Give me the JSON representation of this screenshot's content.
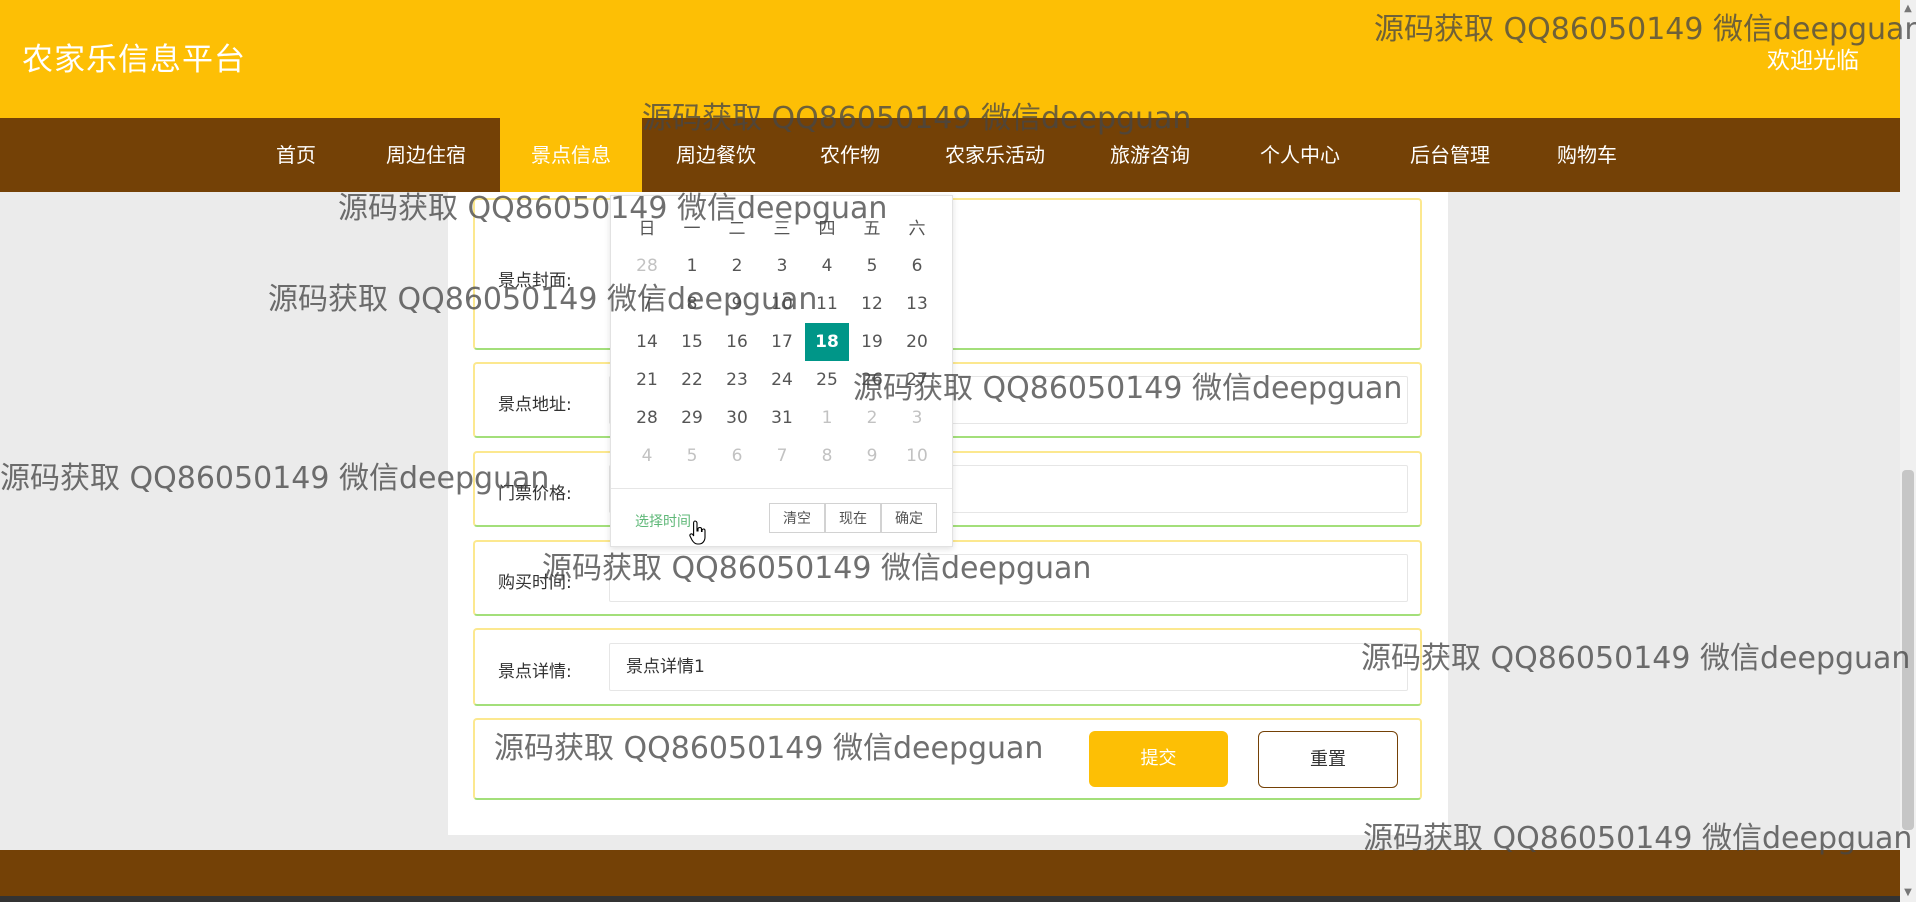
{
  "header": {
    "title": "农家乐信息平台",
    "welcome": "欢迎光临"
  },
  "nav": {
    "items": [
      "首页",
      "周边住宿",
      "景点信息",
      "周边餐饮",
      "农作物",
      "农家乐活动",
      "旅游咨询",
      "个人中心",
      "后台管理",
      "购物车"
    ],
    "active_index": 2
  },
  "form": {
    "cover_label": "景点封面:",
    "address_label": "景点地址:",
    "address_value": "",
    "price_label": "门票价格:",
    "price_value": "",
    "purchase_time_label": "购买时间:",
    "purchase_time_value": "",
    "details_label": "景点详情:",
    "details_value": "景点详情1",
    "submit_label": "提交",
    "reset_label": "重置"
  },
  "calendar": {
    "weekdays": [
      "日",
      "一",
      "二",
      "三",
      "四",
      "五",
      "六"
    ],
    "weeks": [
      [
        "28",
        "1",
        "2",
        "3",
        "4",
        "5",
        "6"
      ],
      [
        "7",
        "8",
        "9",
        "10",
        "11",
        "12",
        "13"
      ],
      [
        "14",
        "15",
        "16",
        "17",
        "18",
        "19",
        "20"
      ],
      [
        "21",
        "22",
        "23",
        "24",
        "25",
        "26",
        "27"
      ],
      [
        "28",
        "29",
        "30",
        "31",
        "1",
        "2",
        "3"
      ],
      [
        "4",
        "5",
        "6",
        "7",
        "8",
        "9",
        "10"
      ]
    ],
    "selected_day": "18",
    "select_time_label": "选择时间",
    "clear_label": "清空",
    "now_label": "现在",
    "confirm_label": "确定"
  },
  "watermark_text": "源码获取 QQ86050149 微信deepguan",
  "colors": {
    "header_bg": "#fdbf05",
    "nav_bg": "#744106",
    "selected_day": "#009688",
    "select_time": "#5fb878"
  }
}
